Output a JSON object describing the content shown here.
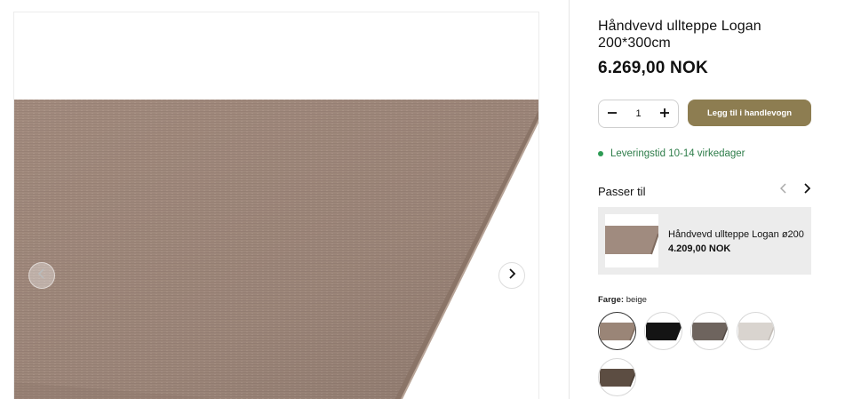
{
  "gallery": {
    "prev_icon": "chevron-left-icon",
    "next_icon": "chevron-right-icon",
    "image_alt": "beige wool rug corner"
  },
  "product": {
    "title": "Håndvevd ullteppe Logan 200*300cm",
    "price": "6.269,00 NOK"
  },
  "quantity": {
    "value": "1",
    "minus_icon": "minus-icon",
    "plus_icon": "plus-icon"
  },
  "cart": {
    "add_label": "Legg til i handlevogn"
  },
  "delivery": {
    "text": "Leveringstid 10-14 virkedager",
    "status_color": "#2e9b55"
  },
  "related": {
    "heading": "Passer til",
    "items": [
      {
        "name": "Håndvevd ullteppe Logan ø200",
        "price": "4.209,00 NOK"
      }
    ]
  },
  "color": {
    "label": "Farge:",
    "selected": "beige",
    "swatches": [
      {
        "color": "#9a8577",
        "selected": true
      },
      {
        "color": "#141414",
        "selected": false
      },
      {
        "color": "#6e645e",
        "selected": false
      },
      {
        "color": "#d9d4cf",
        "selected": false
      },
      {
        "color": "#5c4d42",
        "selected": false
      }
    ]
  },
  "colors": {
    "accent": "#8d7d51",
    "card_bg": "#ececec"
  }
}
